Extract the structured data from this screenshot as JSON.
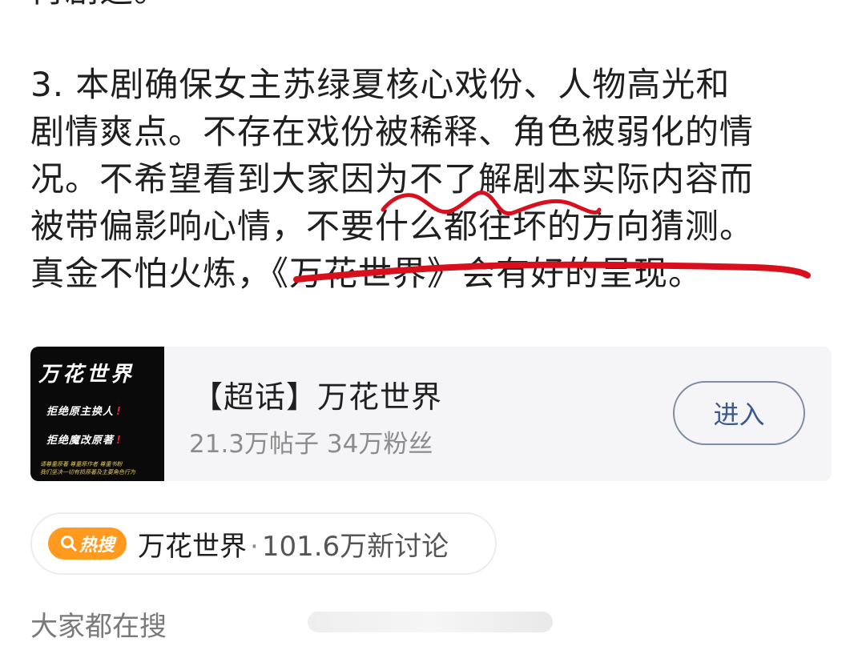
{
  "post": {
    "line_prev": "再剧透。",
    "paragraph3": "3. 本剧确保女主苏绿夏核心戏份、人物高光和\n剧情爽点。不存在戏份被稀释、角色被弱化的情\n况。不希望看到大家因为不了解剧本实际内容而\n被带偏影响心情，不要什么都往坏的方向猜测。\n真金不怕火炼，《万花世界》会有好的呈现。"
  },
  "topic_card": {
    "cover": {
      "title": "万花世界",
      "line1": "拒绝原主换人",
      "line2": "拒绝魔改原著",
      "exclaim": "!",
      "small1": "请尊重原著 尊重原作者 尊重书粉",
      "small2": "我们坚决一切有损原著及主要角色行为"
    },
    "title": "【超话】万花世界",
    "stats": "21.3万帖子 34万粉丝",
    "enter_label": "进入"
  },
  "hot_search": {
    "badge": "热搜",
    "topic": "万花世界",
    "separator": "·",
    "count": "101.6万新讨论"
  },
  "everyone_search": {
    "label": "大家都在搜"
  },
  "colors": {
    "annotation_red": "#d8101e",
    "hot_badge": "#ff9a1f",
    "enter_border": "#7c8ba6"
  }
}
